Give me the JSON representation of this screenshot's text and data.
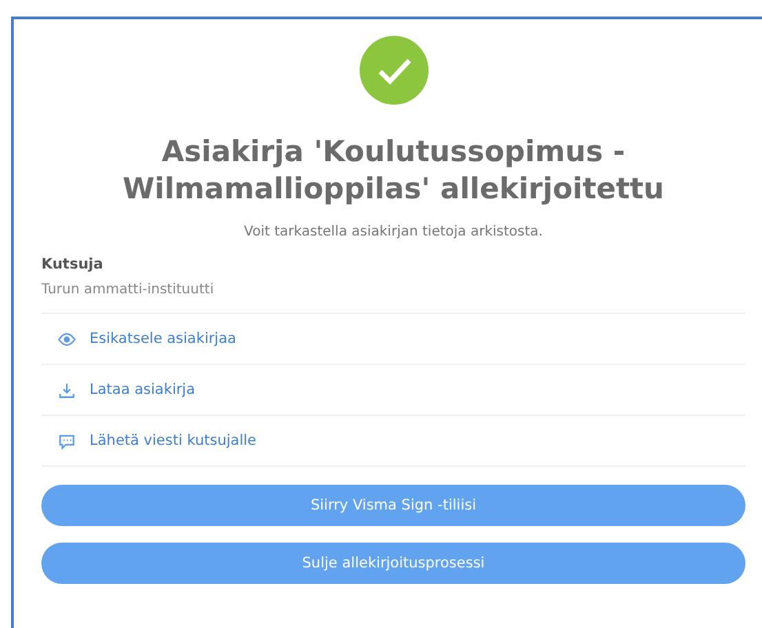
{
  "title": "Asiakirja 'Koulutussopimus - Wilmamallioppilas' allekirjoitettu",
  "subtitle": "Voit tarkastella asiakirjan tietoja arkistosta.",
  "inviter": {
    "label": "Kutsuja",
    "value": "Turun ammatti-instituutti"
  },
  "actions": [
    {
      "kind": "eye",
      "label": "Esikatsele asiakirjaa"
    },
    {
      "kind": "download",
      "label": "Lataa asiakirja"
    },
    {
      "kind": "message",
      "label": "Lähetä viesti kutsujalle"
    }
  ],
  "buttons": [
    "Siirry Visma Sign -tiliisi",
    "Sulje allekirjoitusprosessi"
  ]
}
